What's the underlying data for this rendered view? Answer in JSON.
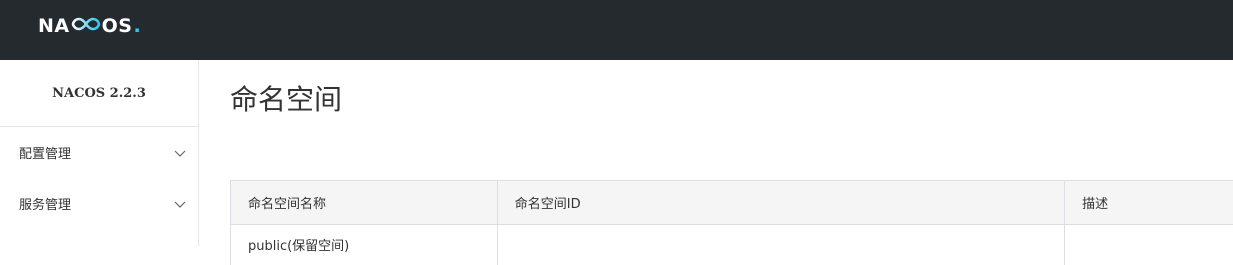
{
  "header": {
    "logo_left": "NA",
    "logo_right": "OS",
    "logo_dot": ".",
    "logo_infinity_icon": "infinity-icon",
    "accent": "#2ec7f5",
    "background": "#252a2f"
  },
  "sidebar": {
    "version": "NACOS 2.2.3",
    "items": [
      {
        "label": "配置管理",
        "icon": "chevron-down-icon"
      },
      {
        "label": "服务管理",
        "icon": "chevron-down-icon"
      }
    ]
  },
  "main": {
    "title": "命名空间",
    "table": {
      "columns": [
        "命名空间名称",
        "命名空间ID",
        "描述"
      ],
      "rows": [
        [
          "public(保留空间)",
          "",
          ""
        ]
      ]
    }
  }
}
